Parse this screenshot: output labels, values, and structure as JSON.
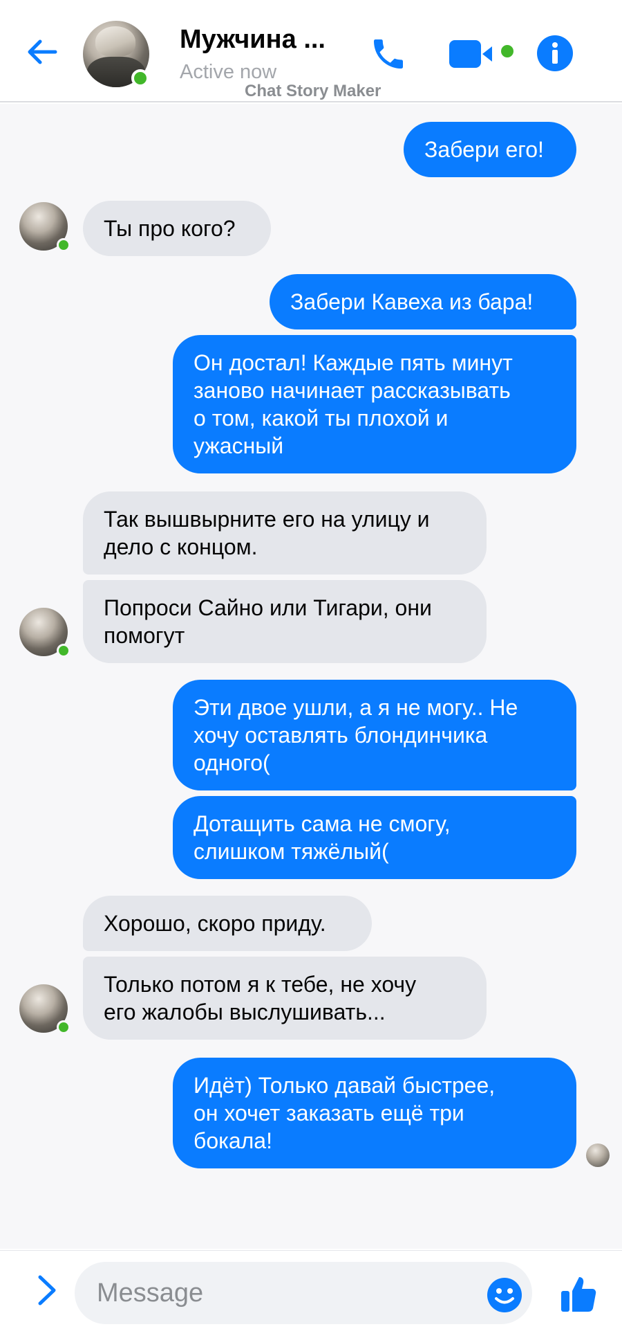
{
  "header": {
    "contact_name": "Мужчина ...",
    "status": "Active now",
    "watermark": "Chat Story Maker",
    "accent_color": "#0a7cff",
    "online_color": "#42b72a",
    "icons": [
      "arrow-left-icon",
      "phone-icon",
      "video-camera-icon",
      "info-icon"
    ]
  },
  "messages": [
    {
      "from": "me",
      "text": "Забери его!"
    },
    {
      "from": "contact",
      "text": "Ты про кого?"
    },
    {
      "from": "me",
      "text": "Забери Кавеха из бара!"
    },
    {
      "from": "me",
      "lines": [
        "Он достал! Каждые пять минут",
        "заново начинает рассказывать",
        "о том, какой ты плохой и",
        "ужасный"
      ]
    },
    {
      "from": "contact",
      "lines": [
        "Так вышвырните его на улицу и",
        "дело с концом."
      ]
    },
    {
      "from": "contact",
      "lines": [
        "Попроси Сайно или Тигари, они",
        "помогут"
      ]
    },
    {
      "from": "me",
      "lines": [
        "Эти двое ушли, а я не могу..  Не",
        "хочу оставлять блондинчика",
        "одного("
      ]
    },
    {
      "from": "me",
      "lines": [
        "Дотащить сама не смогу,",
        "слишком тяжёлый("
      ]
    },
    {
      "from": "contact",
      "text": "Хорошо, скоро приду."
    },
    {
      "from": "contact",
      "lines": [
        "Только потом я к тебе, не хочу",
        "его жалобы выслушивать..."
      ]
    },
    {
      "from": "me",
      "lines": [
        "Идёт) Только давай быстрее,",
        "он хочет заказать ещё три",
        "бокала!"
      ]
    }
  ],
  "composer": {
    "placeholder": "Message",
    "icons": [
      "chevron-right-icon",
      "smiley-icon",
      "thumbs-up-icon"
    ]
  }
}
